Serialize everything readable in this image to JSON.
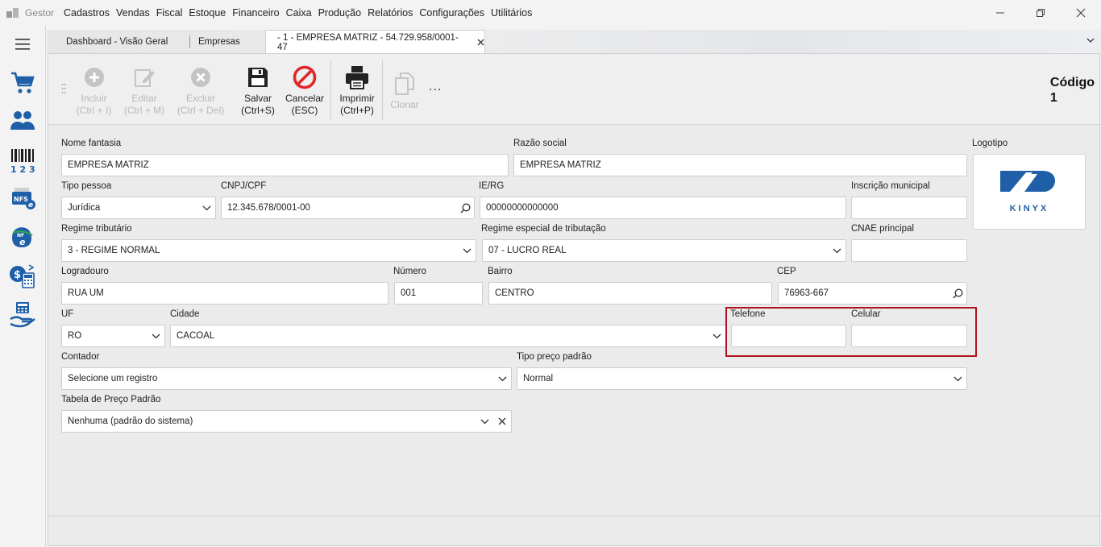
{
  "app": {
    "name": "Gestor"
  },
  "menu": [
    "Cadastros",
    "Vendas",
    "Fiscal",
    "Estoque",
    "Financeiro",
    "Caixa",
    "Produção",
    "Relatórios",
    "Configurações",
    "Utilitários"
  ],
  "tabs": [
    {
      "label": "Dashboard - Visão Geral"
    },
    {
      "label": "Empresas"
    },
    {
      "label": "- 1 - EMPRESA MATRIZ - 54.729.958/0001-47"
    }
  ],
  "toolbar": {
    "incluir": {
      "l1": "Incluir",
      "l2": "(Ctrl + I)"
    },
    "editar": {
      "l1": "Editar",
      "l2": "(Ctrl + M)"
    },
    "excluir": {
      "l1": "Excluir",
      "l2": "(Ctrl + Del)"
    },
    "salvar": {
      "l1": "Salvar",
      "l2": "(Ctrl+S)"
    },
    "cancelar": {
      "l1": "Cancelar",
      "l2": "(ESC)"
    },
    "imprimir": {
      "l1": "Imprimir",
      "l2": "(Ctrl+P)"
    },
    "clonar": {
      "l1": "Clonar"
    },
    "more": "..."
  },
  "codigo": {
    "label": "Código",
    "value": "1"
  },
  "form": {
    "nome_fantasia": {
      "label": "Nome fantasia",
      "value": "EMPRESA MATRIZ"
    },
    "razao_social": {
      "label": "Razão social",
      "value": "EMPRESA MATRIZ"
    },
    "logotipo": {
      "label": "Logotipo",
      "brand": "KINYX"
    },
    "tipo_pessoa": {
      "label": "Tipo pessoa",
      "value": "Jurídica"
    },
    "cnpj_cpf": {
      "label": "CNPJ/CPF",
      "value": "12.345.678/0001-00"
    },
    "ie_rg": {
      "label": "IE/RG",
      "value": "00000000000000"
    },
    "inscricao_municipal": {
      "label": "Inscrição municipal",
      "value": ""
    },
    "regime_tributario": {
      "label": "Regime tributário",
      "value": "3 - REGIME NORMAL"
    },
    "regime_especial": {
      "label": "Regime especial de tributação",
      "value": "07 - LUCRO REAL"
    },
    "cnae": {
      "label": "CNAE principal",
      "value": ""
    },
    "logradouro": {
      "label": "Logradouro",
      "value": "RUA UM"
    },
    "numero": {
      "label": "Número",
      "value": "001"
    },
    "bairro": {
      "label": "Bairro",
      "value": "CENTRO"
    },
    "cep": {
      "label": "CEP",
      "value": "76963-667"
    },
    "uf": {
      "label": "UF",
      "value": "RO"
    },
    "cidade": {
      "label": "Cidade",
      "value": "CACOAL"
    },
    "telefone": {
      "label": "Telefone",
      "value": ""
    },
    "celular": {
      "label": "Celular",
      "value": ""
    },
    "contador": {
      "label": "Contador",
      "value": "Selecione um registro"
    },
    "tipo_preco": {
      "label": "Tipo preço padrão",
      "value": "Normal"
    },
    "tabela_preco": {
      "label": "Tabela de Preço Padrão",
      "value": "Nenhuma (padrão do sistema)"
    }
  },
  "colors": {
    "highlight": "#b3121c",
    "accent": "#1f5fa8"
  }
}
